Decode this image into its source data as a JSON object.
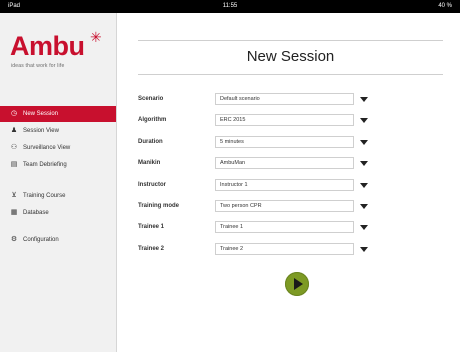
{
  "statusbar": {
    "carrier": "iPad",
    "time": "11:55",
    "battery": "40 %"
  },
  "brand": {
    "name": "Ambu",
    "tagline": "ideas that work for life"
  },
  "sidebar": {
    "items": [
      {
        "label": "New Session",
        "icon": "clock-icon",
        "active": true
      },
      {
        "label": "Session View",
        "icon": "person-icon"
      },
      {
        "label": "Surveillance View",
        "icon": "people-icon"
      },
      {
        "label": "Team Debriefing",
        "icon": "document-icon"
      },
      {
        "label": "Training Course",
        "icon": "training-course-icon"
      },
      {
        "label": "Database",
        "icon": "database-icon"
      },
      {
        "label": "Configuration",
        "icon": "configuration-icon"
      }
    ]
  },
  "main": {
    "title": "New Session",
    "fields": [
      {
        "label": "Scenario",
        "value": "Default scenario"
      },
      {
        "label": "Algorithm",
        "value": "ERC 2015"
      },
      {
        "label": "Duration",
        "value": "5 minutes"
      },
      {
        "label": "Manikin",
        "value": "AmbuMan"
      },
      {
        "label": "Instructor",
        "value": "Instructor 1"
      },
      {
        "label": "Training mode",
        "value": "Two person CPR"
      },
      {
        "label": "Trainee 1",
        "value": "Trainee 1"
      },
      {
        "label": "Trainee 2",
        "value": "Trainee 2"
      }
    ]
  },
  "colors": {
    "brand": "#c8102e",
    "play": "#7d9a24"
  }
}
